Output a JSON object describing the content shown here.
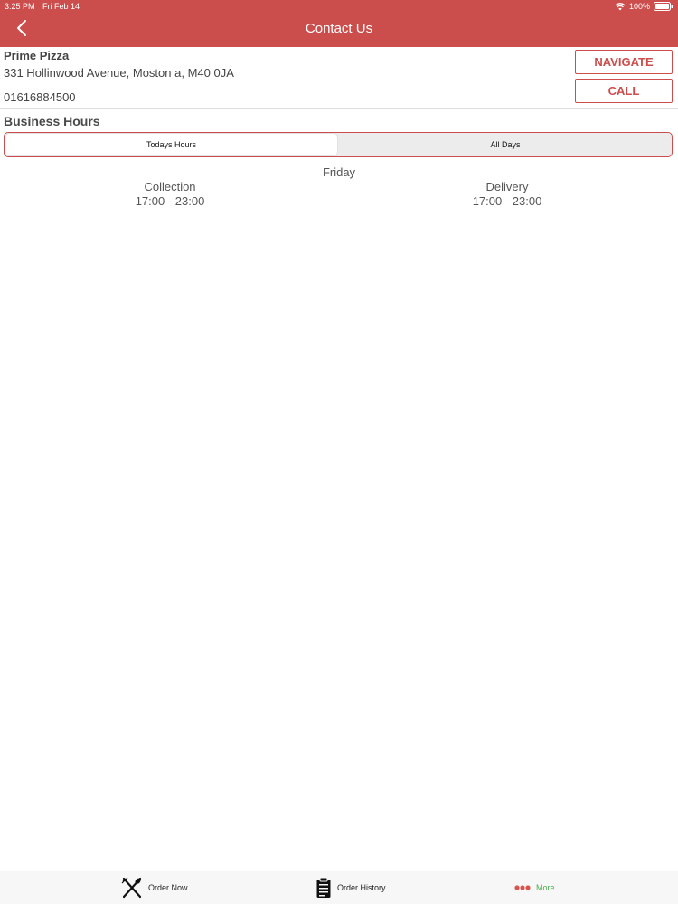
{
  "status_bar": {
    "time": "3:25 PM",
    "date": "Fri Feb 14",
    "battery": "100%"
  },
  "nav": {
    "title": "Contact Us",
    "back_icon": "chevron-left-icon"
  },
  "store": {
    "name": "Prime Pizza",
    "address": "331 Hollinwood Avenue, Moston a, M40 0JA",
    "phone": "01616884500",
    "navigate_label": "NAVIGATE",
    "call_label": "CALL"
  },
  "hours": {
    "heading": "Business Hours",
    "tabs": [
      {
        "label": "Todays Hours",
        "selected": true
      },
      {
        "label": "All Days",
        "selected": false
      }
    ],
    "day": "Friday",
    "columns": [
      {
        "label": "Collection",
        "time": "17:00 - 23:00"
      },
      {
        "label": "Delivery",
        "time": "17:00 - 23:00"
      }
    ]
  },
  "tabbar": {
    "items": [
      {
        "label": "Order Now",
        "icon": "fork-knife-icon"
      },
      {
        "label": "Order History",
        "icon": "clipboard-icon"
      },
      {
        "label": "More",
        "icon": "dots-icon",
        "selected": true
      }
    ]
  },
  "colors": {
    "accent": "#cc4e4c",
    "selected_tab": "#4caf50",
    "more_dots": "#d9534f"
  }
}
